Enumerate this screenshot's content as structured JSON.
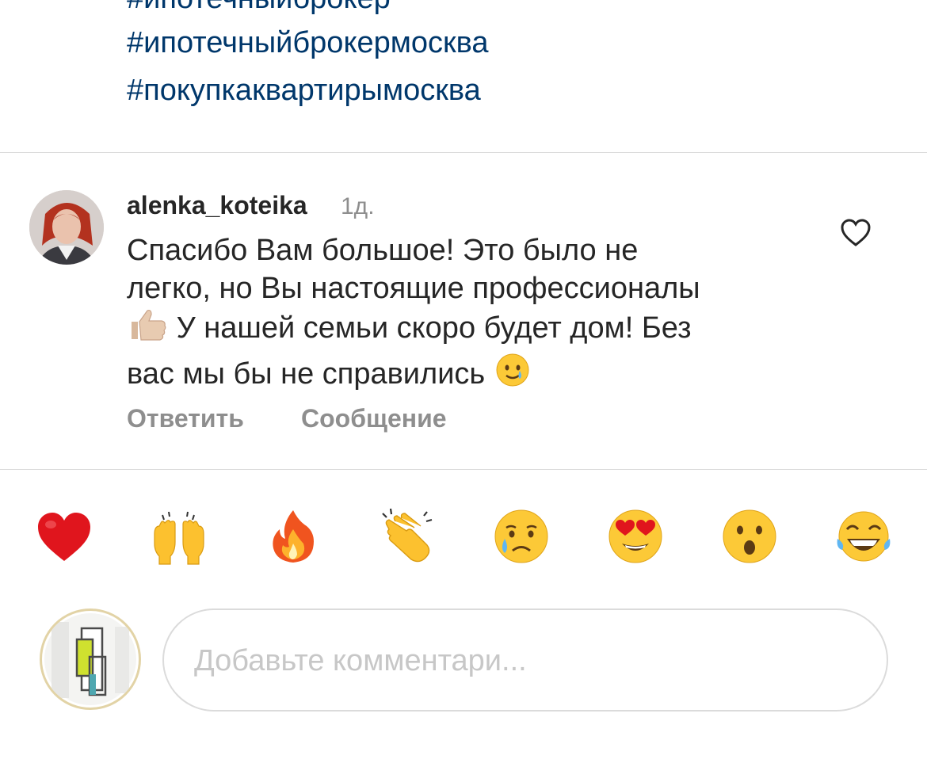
{
  "caption": {
    "hashtags": [
      "#ипотечныйброкер",
      "#ипотечныйброкермосква",
      "#покупкаквартирымосква"
    ]
  },
  "comment": {
    "username": "alenka_koteika",
    "age": "1д.",
    "text_line1": "Спасибо Вам большое! Это было не",
    "text_line2": "легко, но Вы настоящие профессионалы",
    "text_line3": "У нашей семьи скоро будет дом! Без",
    "text_line4": "вас мы бы не справились",
    "emoji_thumbs": "thumbs-up-emoji",
    "emoji_tear": "smiling-face-with-tear-emoji",
    "like_icon": "heart-outline-icon",
    "reply_label": "Ответить",
    "message_label": "Сообщение"
  },
  "quick_reactions": [
    {
      "icon": "red-heart-emoji"
    },
    {
      "icon": "raising-hands-emoji"
    },
    {
      "icon": "fire-emoji"
    },
    {
      "icon": "clapping-hands-emoji"
    },
    {
      "icon": "crying-face-emoji"
    },
    {
      "icon": "heart-eyes-emoji"
    },
    {
      "icon": "face-with-open-mouth-emoji"
    },
    {
      "icon": "tears-of-joy-emoji"
    }
  ],
  "composer": {
    "placeholder": "Добавьте комментари...",
    "value": ""
  },
  "colors": {
    "hashtag": "#00376b",
    "text": "#262626",
    "secondary": "#8e8e8e",
    "divider": "#dbdbdb",
    "placeholder": "#c7c7c7"
  }
}
